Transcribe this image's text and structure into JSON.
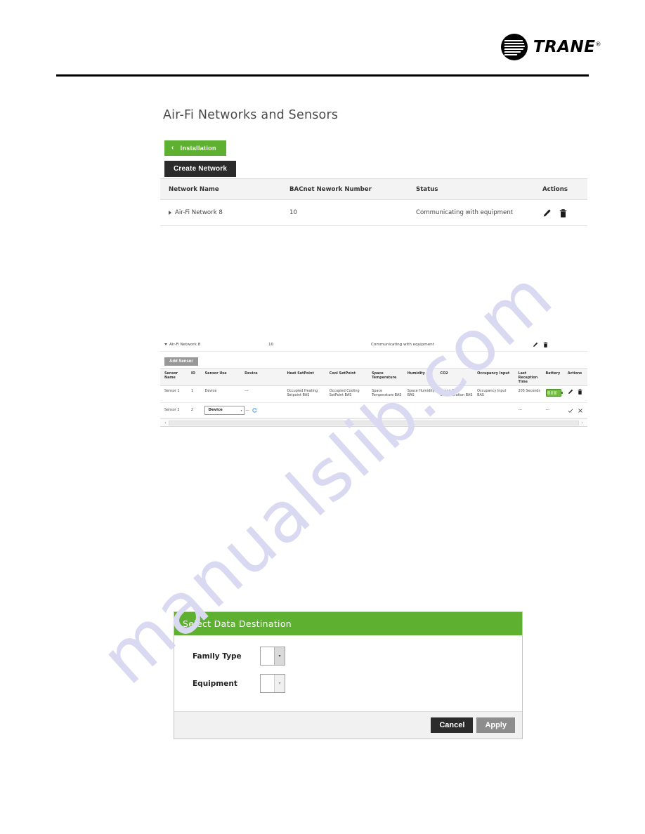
{
  "brand": {
    "logo_word": "TRANE",
    "logo_tm": "®",
    "accent_green": "#5eb130",
    "dark": "#2b2b2b"
  },
  "page": {
    "title": "Air-Fi Networks and Sensors"
  },
  "toolbar": {
    "back_chevron": "‹",
    "installation_label": "Installation",
    "create_network_label": "Create Network"
  },
  "networks_table": {
    "columns": [
      "Network Name",
      "BACnet Nework Number",
      "Status",
      "Actions"
    ],
    "rows": [
      {
        "name": "Air-Fi Network 8",
        "bacnet_number": "10",
        "status": "Communicating with equipment",
        "expanded": false,
        "actions": [
          "edit-pencil-icon",
          "delete-trash-icon"
        ]
      }
    ]
  },
  "sensors_panel": {
    "network_row": {
      "name": "Air-Fi Network 8",
      "bacnet_number": "10",
      "status": "Communicating with equipment",
      "expanded": true
    },
    "add_sensor_label": "Add Sensor",
    "columns": [
      "Sensor Name",
      "ID",
      "Sensor Use",
      "Device",
      "Heat SetPoint",
      "Cool SetPoint",
      "Space Temperature",
      "Humidity",
      "CO2",
      "Occupancy Input",
      "Last Reception Time",
      "Battery",
      "Actions"
    ],
    "rows": [
      {
        "sensor_name": "Sensor 1",
        "id": "1",
        "sensor_use": "Device",
        "device": "---",
        "heat_setpoint": "Occupied Heating Setpoint BAS",
        "cool_setpoint": "Occupied Cooling SetPoint BAS",
        "space_temperature": "Space Temperature BAS",
        "humidity": "Space Humidity BAS",
        "co2": "Space CO2 Concentration BAS",
        "occupancy_input": "Occupancy Input BAS",
        "last_reception_time": "205 Seconds",
        "battery": "battery-full-icon",
        "editing": false,
        "actions": [
          "edit-pencil-icon",
          "delete-trash-icon"
        ]
      },
      {
        "sensor_name": "Sensor 2",
        "id": "2",
        "sensor_use": "Device",
        "sensor_use_arrow": "▾",
        "device": "---",
        "device_loading": "refresh-icon",
        "heat_setpoint": "",
        "cool_setpoint": "",
        "space_temperature": "",
        "humidity": "",
        "co2": "",
        "occupancy_input": "",
        "last_reception_time": "---",
        "battery": "---",
        "editing": true,
        "actions": [
          "confirm-check-icon",
          "cancel-x-icon"
        ]
      }
    ],
    "scrollbar": {
      "left_arrow": "‹",
      "right_arrow": "›"
    }
  },
  "dialog": {
    "title": "Select Data Destination",
    "fields": [
      {
        "label": "Family Type",
        "value": ""
      },
      {
        "label": "Equipment",
        "value": ""
      }
    ],
    "cancel_label": "Cancel",
    "apply_label": "Apply",
    "dropdown_arrow": "▾"
  },
  "watermark": {
    "text": "manualslib.com",
    "color": "#d9d9f2"
  }
}
